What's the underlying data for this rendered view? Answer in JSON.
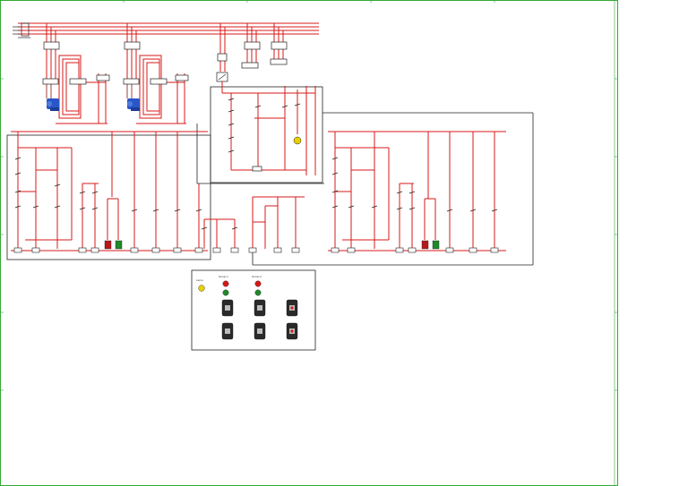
{
  "colors": {
    "frame": "#35a835",
    "wire": "#d81818",
    "wire_dark": "#8a1010",
    "box": "#222222",
    "motor": "#2a56c8",
    "lamp_red": "#b81818",
    "lamp_green": "#1f8a2a",
    "lamp_yellow": "#e8d000"
  },
  "panel": {
    "caption_lamp": "Lamp",
    "caption_group_1": "Group 1",
    "caption_group_2": "Group 2"
  }
}
